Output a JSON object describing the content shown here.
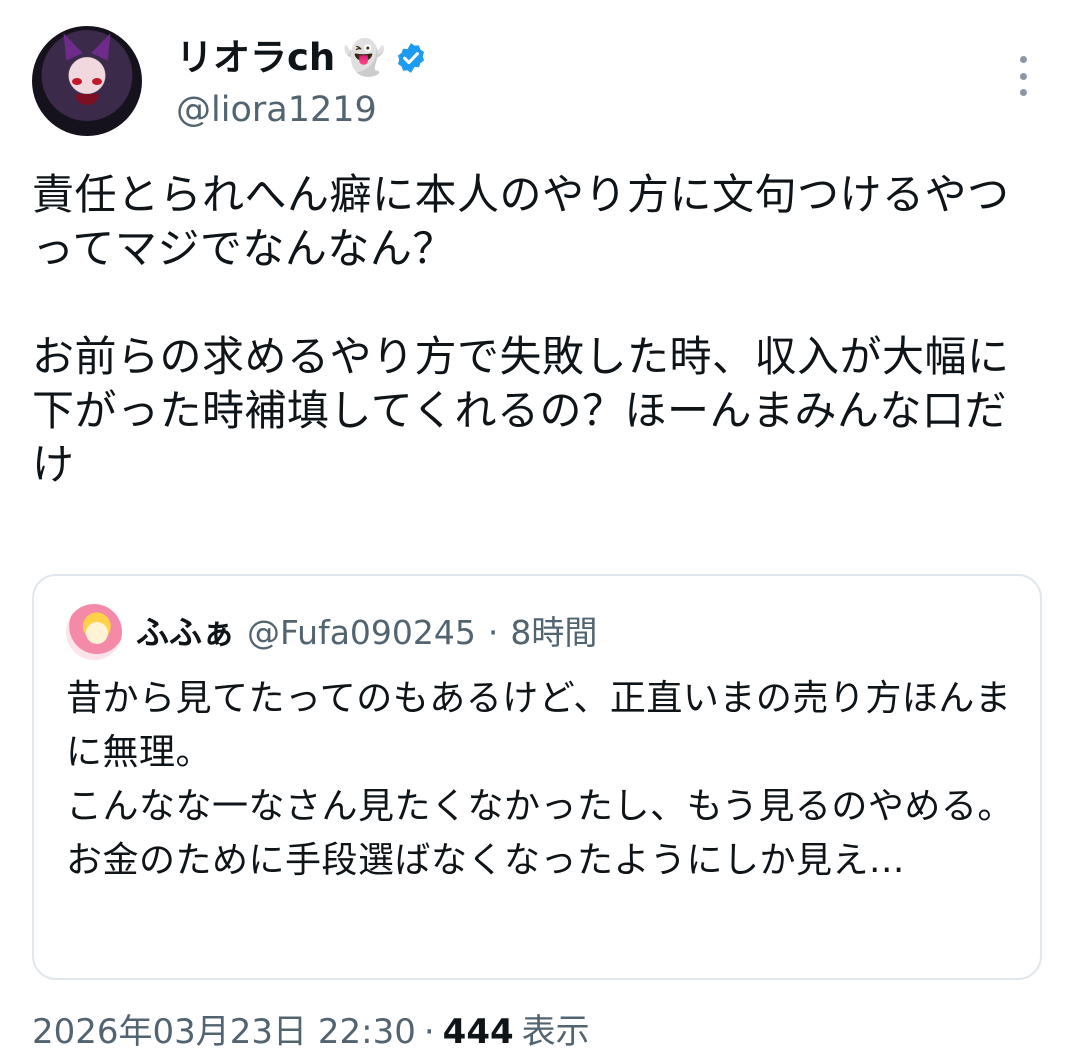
{
  "tweet": {
    "author": {
      "display_name": "リオラch",
      "emoji": "👻",
      "verified_icon": "verified-badge-icon",
      "handle": "@liora1219"
    },
    "text": "責任とられへん癖に本人のやり方に文句つけるやつってマジでなんなん？\n\nお前らの求めるやり方で失敗した時、収入が大幅に下がった時補填してくれるの？ほーんまみんな口だけ",
    "quoted": {
      "display_name": "ふふぁ",
      "handle": "@Fufa090245",
      "separator": "·",
      "time": "8時間",
      "text": "昔から見てたってのもあるけど、正直いまの売り方ほんまに無理。\nこんなな一なさん見たくなかったし、もう見るのやめる。\nお金のために手段選ばなくなったようにしか見え..."
    },
    "timestamp": "2026年03月23日 22:30",
    "separator": "·",
    "views_count": "444",
    "views_label": "表示"
  },
  "colors": {
    "text": "#0f1419",
    "secondary": "#536471",
    "verified": "#1d9bf0",
    "border": "#e1e8ed"
  }
}
